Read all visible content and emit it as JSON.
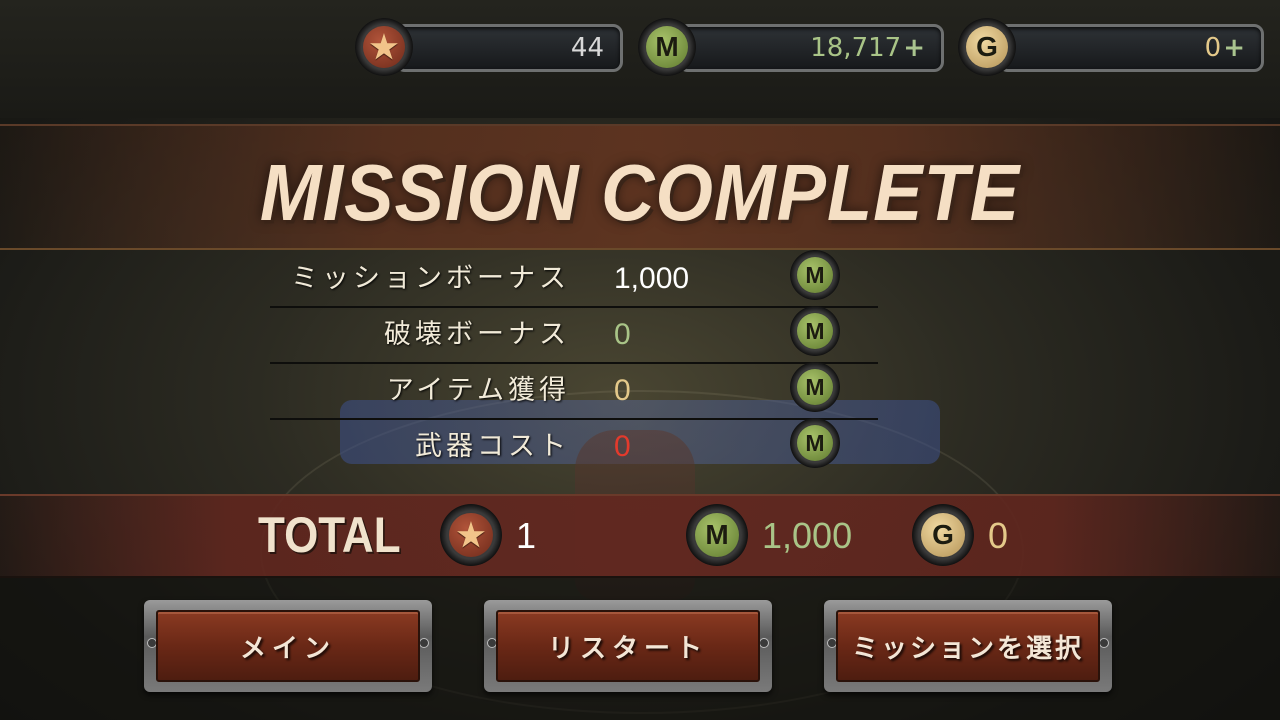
{
  "currency": {
    "stars": {
      "value": "44",
      "icon": "star-icon"
    },
    "medals": {
      "letter": "M",
      "value": "18,717",
      "plus": "+"
    },
    "gold": {
      "letter": "G",
      "value": "0",
      "plus": "+"
    }
  },
  "title": "MISSION COMPLETE",
  "rows": [
    {
      "label": "ミッションボーナス",
      "value": "1,000",
      "color": "#ffffff",
      "letter": "M"
    },
    {
      "label": "破壊ボーナス",
      "value": "0",
      "color": "#a9c487",
      "letter": "M"
    },
    {
      "label": "アイテム獲得",
      "value": "0",
      "color": "#e4c98a",
      "letter": "M"
    },
    {
      "label": "武器コスト",
      "value": "0",
      "color": "#e33a2c",
      "letter": "M"
    }
  ],
  "total": {
    "label": "TOTAL",
    "stars": "1",
    "medal_letter": "M",
    "medals": "1,000",
    "gold_letter": "G",
    "gold": "0"
  },
  "buttons": {
    "main": "メイン",
    "restart": "リスタート",
    "select": "ミッションを選択"
  },
  "colors": {
    "medal_text": "#a9c487",
    "gold_text": "#e4c98a",
    "star_text": "#ffffff",
    "banner_text": "#f5dfc4"
  }
}
